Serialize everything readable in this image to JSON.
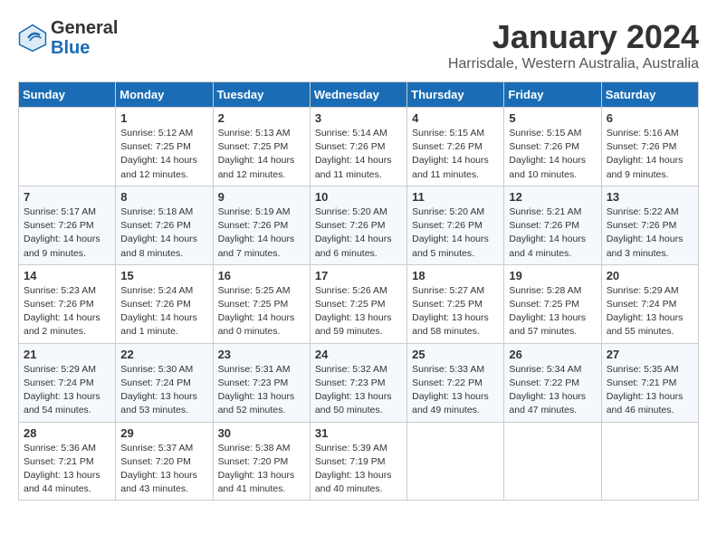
{
  "header": {
    "logo_text1": "General",
    "logo_text2": "Blue",
    "title": "January 2024",
    "subtitle": "Harrisdale, Western Australia, Australia"
  },
  "days_of_week": [
    "Sunday",
    "Monday",
    "Tuesday",
    "Wednesday",
    "Thursday",
    "Friday",
    "Saturday"
  ],
  "weeks": [
    [
      {
        "num": "",
        "info": ""
      },
      {
        "num": "1",
        "info": "Sunrise: 5:12 AM\nSunset: 7:25 PM\nDaylight: 14 hours\nand 12 minutes."
      },
      {
        "num": "2",
        "info": "Sunrise: 5:13 AM\nSunset: 7:25 PM\nDaylight: 14 hours\nand 12 minutes."
      },
      {
        "num": "3",
        "info": "Sunrise: 5:14 AM\nSunset: 7:26 PM\nDaylight: 14 hours\nand 11 minutes."
      },
      {
        "num": "4",
        "info": "Sunrise: 5:15 AM\nSunset: 7:26 PM\nDaylight: 14 hours\nand 11 minutes."
      },
      {
        "num": "5",
        "info": "Sunrise: 5:15 AM\nSunset: 7:26 PM\nDaylight: 14 hours\nand 10 minutes."
      },
      {
        "num": "6",
        "info": "Sunrise: 5:16 AM\nSunset: 7:26 PM\nDaylight: 14 hours\nand 9 minutes."
      }
    ],
    [
      {
        "num": "7",
        "info": "Sunrise: 5:17 AM\nSunset: 7:26 PM\nDaylight: 14 hours\nand 9 minutes."
      },
      {
        "num": "8",
        "info": "Sunrise: 5:18 AM\nSunset: 7:26 PM\nDaylight: 14 hours\nand 8 minutes."
      },
      {
        "num": "9",
        "info": "Sunrise: 5:19 AM\nSunset: 7:26 PM\nDaylight: 14 hours\nand 7 minutes."
      },
      {
        "num": "10",
        "info": "Sunrise: 5:20 AM\nSunset: 7:26 PM\nDaylight: 14 hours\nand 6 minutes."
      },
      {
        "num": "11",
        "info": "Sunrise: 5:20 AM\nSunset: 7:26 PM\nDaylight: 14 hours\nand 5 minutes."
      },
      {
        "num": "12",
        "info": "Sunrise: 5:21 AM\nSunset: 7:26 PM\nDaylight: 14 hours\nand 4 minutes."
      },
      {
        "num": "13",
        "info": "Sunrise: 5:22 AM\nSunset: 7:26 PM\nDaylight: 14 hours\nand 3 minutes."
      }
    ],
    [
      {
        "num": "14",
        "info": "Sunrise: 5:23 AM\nSunset: 7:26 PM\nDaylight: 14 hours\nand 2 minutes."
      },
      {
        "num": "15",
        "info": "Sunrise: 5:24 AM\nSunset: 7:26 PM\nDaylight: 14 hours\nand 1 minute."
      },
      {
        "num": "16",
        "info": "Sunrise: 5:25 AM\nSunset: 7:25 PM\nDaylight: 14 hours\nand 0 minutes."
      },
      {
        "num": "17",
        "info": "Sunrise: 5:26 AM\nSunset: 7:25 PM\nDaylight: 13 hours\nand 59 minutes."
      },
      {
        "num": "18",
        "info": "Sunrise: 5:27 AM\nSunset: 7:25 PM\nDaylight: 13 hours\nand 58 minutes."
      },
      {
        "num": "19",
        "info": "Sunrise: 5:28 AM\nSunset: 7:25 PM\nDaylight: 13 hours\nand 57 minutes."
      },
      {
        "num": "20",
        "info": "Sunrise: 5:29 AM\nSunset: 7:24 PM\nDaylight: 13 hours\nand 55 minutes."
      }
    ],
    [
      {
        "num": "21",
        "info": "Sunrise: 5:29 AM\nSunset: 7:24 PM\nDaylight: 13 hours\nand 54 minutes."
      },
      {
        "num": "22",
        "info": "Sunrise: 5:30 AM\nSunset: 7:24 PM\nDaylight: 13 hours\nand 53 minutes."
      },
      {
        "num": "23",
        "info": "Sunrise: 5:31 AM\nSunset: 7:23 PM\nDaylight: 13 hours\nand 52 minutes."
      },
      {
        "num": "24",
        "info": "Sunrise: 5:32 AM\nSunset: 7:23 PM\nDaylight: 13 hours\nand 50 minutes."
      },
      {
        "num": "25",
        "info": "Sunrise: 5:33 AM\nSunset: 7:22 PM\nDaylight: 13 hours\nand 49 minutes."
      },
      {
        "num": "26",
        "info": "Sunrise: 5:34 AM\nSunset: 7:22 PM\nDaylight: 13 hours\nand 47 minutes."
      },
      {
        "num": "27",
        "info": "Sunrise: 5:35 AM\nSunset: 7:21 PM\nDaylight: 13 hours\nand 46 minutes."
      }
    ],
    [
      {
        "num": "28",
        "info": "Sunrise: 5:36 AM\nSunset: 7:21 PM\nDaylight: 13 hours\nand 44 minutes."
      },
      {
        "num": "29",
        "info": "Sunrise: 5:37 AM\nSunset: 7:20 PM\nDaylight: 13 hours\nand 43 minutes."
      },
      {
        "num": "30",
        "info": "Sunrise: 5:38 AM\nSunset: 7:20 PM\nDaylight: 13 hours\nand 41 minutes."
      },
      {
        "num": "31",
        "info": "Sunrise: 5:39 AM\nSunset: 7:19 PM\nDaylight: 13 hours\nand 40 minutes."
      },
      {
        "num": "",
        "info": ""
      },
      {
        "num": "",
        "info": ""
      },
      {
        "num": "",
        "info": ""
      }
    ]
  ]
}
